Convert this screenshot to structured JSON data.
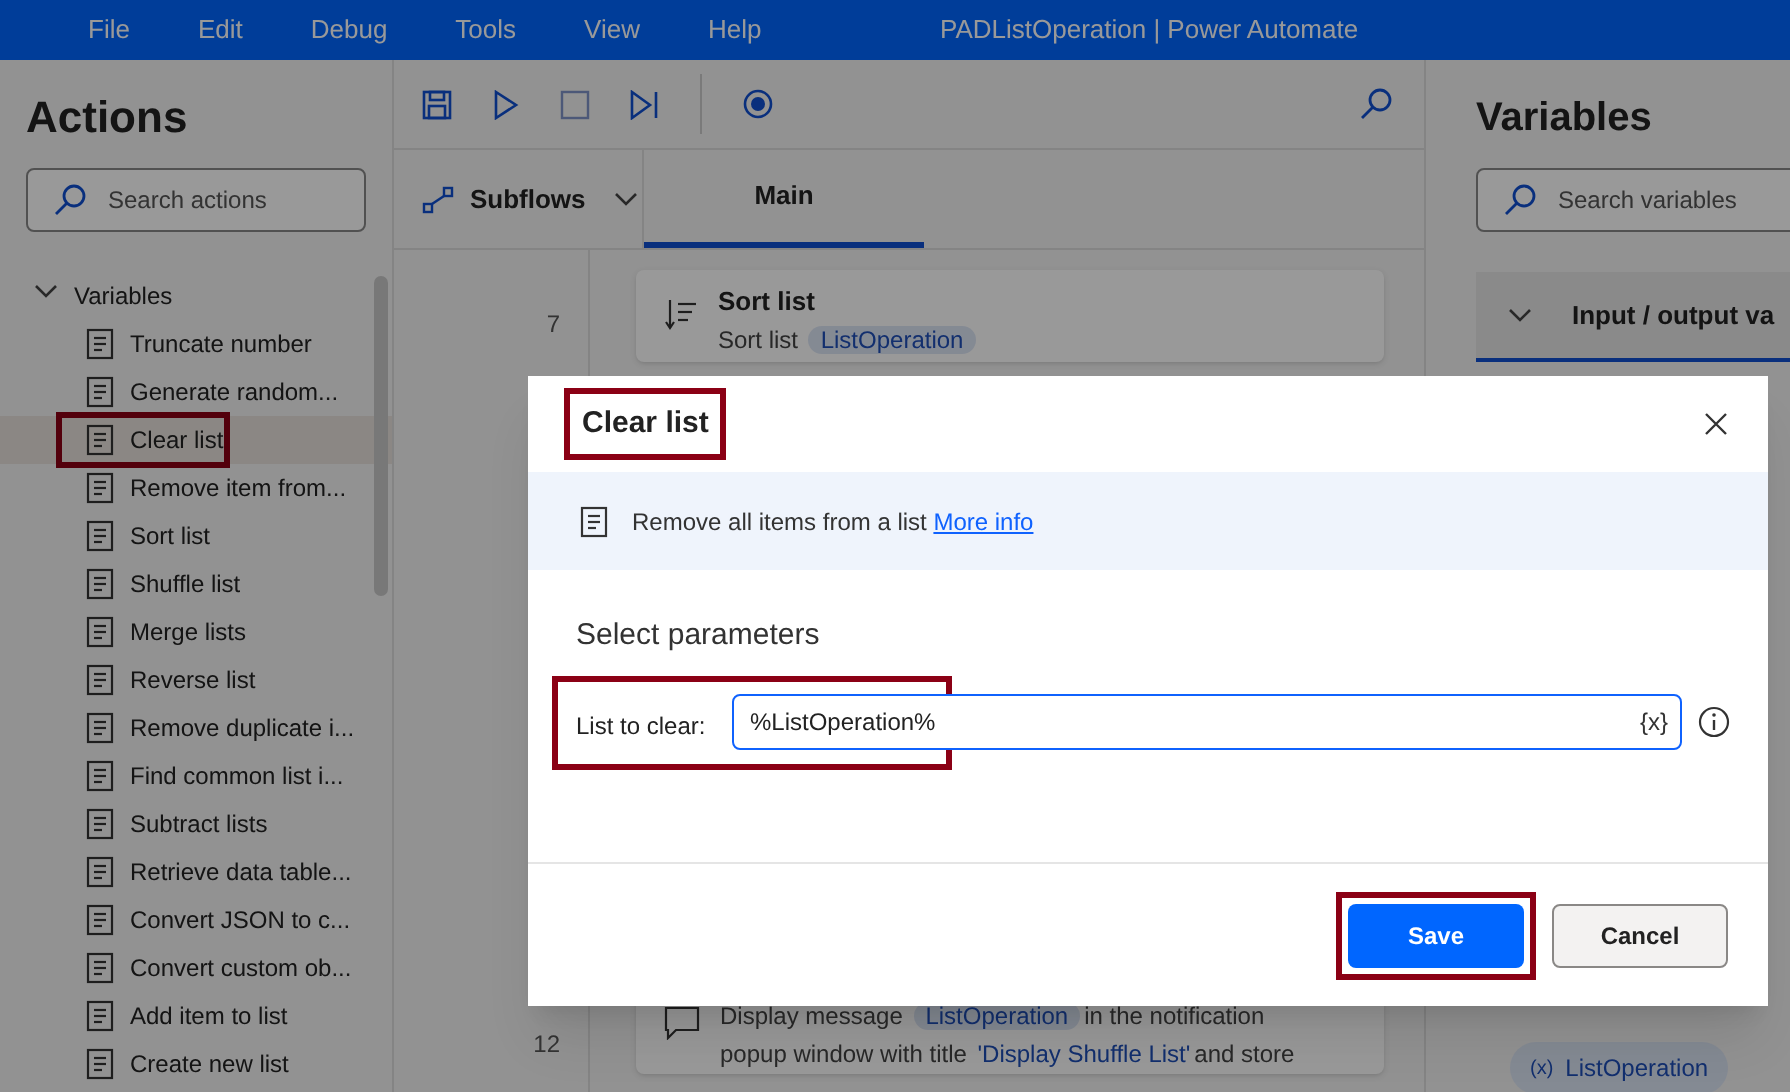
{
  "menu": [
    "File",
    "Edit",
    "Debug",
    "Tools",
    "View",
    "Help"
  ],
  "window": {
    "title": "PADListOperation | Power Automate"
  },
  "actions_panel": {
    "title": "Actions",
    "search": {
      "placeholder": "Search actions"
    },
    "group": {
      "label": "Variables",
      "expanded": true
    },
    "items": [
      {
        "label": "Truncate number",
        "selected": false,
        "highlighted": false
      },
      {
        "label": "Generate random...",
        "selected": false,
        "highlighted": false
      },
      {
        "label": "Clear list",
        "selected": true,
        "highlighted": true
      },
      {
        "label": "Remove item from...",
        "selected": false,
        "highlighted": false
      },
      {
        "label": "Sort list",
        "selected": false,
        "highlighted": false
      },
      {
        "label": "Shuffle list",
        "selected": false,
        "highlighted": false
      },
      {
        "label": "Merge lists",
        "selected": false,
        "highlighted": false
      },
      {
        "label": "Reverse list",
        "selected": false,
        "highlighted": false
      },
      {
        "label": "Remove duplicate i...",
        "selected": false,
        "highlighted": false
      },
      {
        "label": "Find common list i...",
        "selected": false,
        "highlighted": false
      },
      {
        "label": "Subtract lists",
        "selected": false,
        "highlighted": false
      },
      {
        "label": "Retrieve data table...",
        "selected": false,
        "highlighted": false
      },
      {
        "label": "Convert JSON to c...",
        "selected": false,
        "highlighted": false
      },
      {
        "label": "Convert custom ob...",
        "selected": false,
        "highlighted": false
      },
      {
        "label": "Add item to list",
        "selected": false,
        "highlighted": false
      },
      {
        "label": "Create new list",
        "selected": false,
        "highlighted": false
      }
    ]
  },
  "flow": {
    "subflows_label": "Subflows",
    "tabs": [
      {
        "label": "Main",
        "selected": true
      }
    ],
    "steps": [
      {
        "number": "7",
        "title": "Sort list",
        "parts": [
          {
            "kind": "text",
            "text": "Sort list"
          },
          {
            "kind": "token",
            "text": "ListOperation"
          }
        ]
      },
      {
        "number": "12",
        "parts": [
          {
            "kind": "text",
            "text": "Display message"
          },
          {
            "kind": "token",
            "text": "ListOperation"
          },
          {
            "kind": "text",
            "text": "in the notification popup window with title"
          },
          {
            "kind": "quote",
            "text": "'Display Shuffle List'"
          },
          {
            "kind": "text",
            "text": "and store"
          }
        ]
      }
    ]
  },
  "variables_panel": {
    "title": "Variables",
    "search": {
      "placeholder": "Search variables"
    },
    "section": {
      "label": "Input / output va",
      "expanded": true
    },
    "variable_icon": "(x)",
    "variable": "ListOperation"
  },
  "dialog": {
    "title": "Clear list",
    "title_highlighted": true,
    "description": "Remove all items from a list",
    "link": "More info",
    "section": "Select parameters",
    "field": {
      "label": "List to clear:",
      "value": "%ListOperation%",
      "variable_button": "{x}",
      "highlighted": true
    },
    "buttons": [
      {
        "label": "Save",
        "kind": "primary",
        "highlighted": true
      },
      {
        "label": "Cancel",
        "kind": "secondary",
        "highlighted": false
      }
    ]
  }
}
